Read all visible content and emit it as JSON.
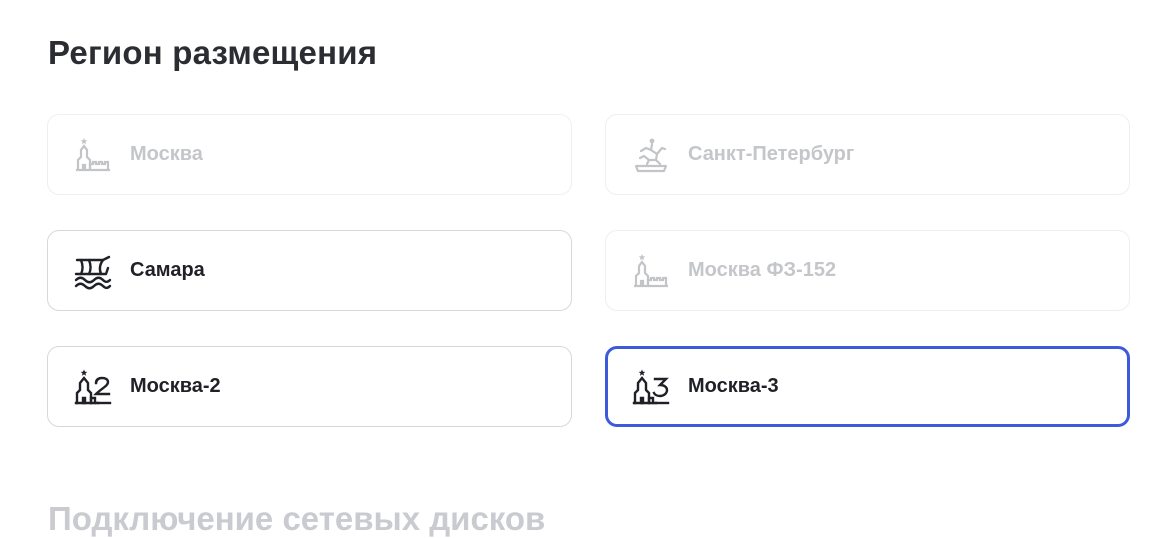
{
  "page": {
    "title": "Регион размещения",
    "next_section_title": "Подключение сетевых дисков"
  },
  "regions": [
    {
      "label": "Москва",
      "icon": "kremlin-tower-icon",
      "state": "disabled"
    },
    {
      "label": "Санкт-Петербург",
      "icon": "bronze-horseman-icon",
      "state": "disabled"
    },
    {
      "label": "Самара",
      "icon": "boat-waves-icon",
      "state": "enabled"
    },
    {
      "label": "Москва ФЗ-152",
      "icon": "kremlin-tower-icon",
      "state": "disabled"
    },
    {
      "label": "Москва-2",
      "icon": "kremlin-tower-2-icon",
      "state": "enabled"
    },
    {
      "label": "Москва-3",
      "icon": "kremlin-tower-3-icon",
      "state": "selected"
    }
  ],
  "colors": {
    "selected_border": "#3d5adb",
    "disabled_text": "#c4c6ca",
    "enabled_text": "#1f2126"
  }
}
